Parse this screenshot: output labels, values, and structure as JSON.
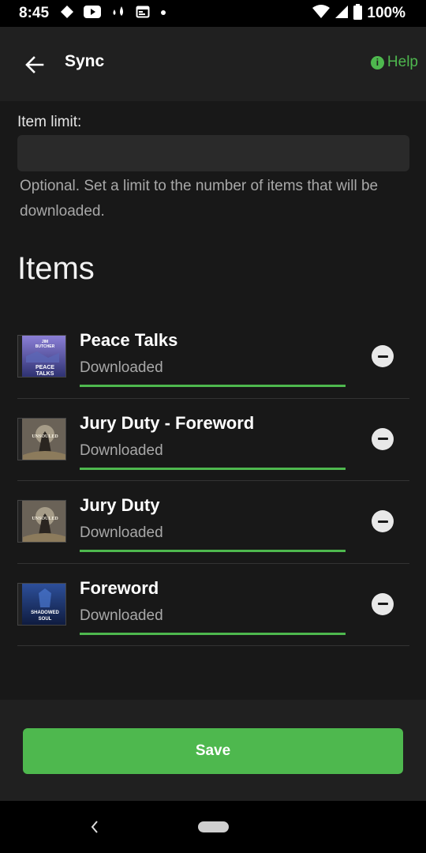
{
  "status_bar": {
    "time": "8:45",
    "battery_text": "100%",
    "icons_left": [
      "notification-diamond-icon",
      "youtube-icon",
      "drops-icon",
      "calendar-icon",
      "dot-icon"
    ],
    "icons_right": [
      "wifi-icon",
      "signal-icon",
      "battery-icon"
    ]
  },
  "app_bar": {
    "title": "Sync",
    "help_label": "Help",
    "back_icon": "arrow-left-icon",
    "help_icon": "info-icon"
  },
  "item_limit": {
    "label": "Item limit:",
    "value": "",
    "placeholder": "",
    "help_text": "Optional. Set a limit to the number of items that will be downloaded."
  },
  "items_section": {
    "heading": "Items",
    "items": [
      {
        "title": "Peace Talks",
        "status": "Downloaded",
        "progress": 1.0,
        "cover_text": [
          "JIM",
          "BUTCHER",
          "PEACE",
          "TALKS"
        ]
      },
      {
        "title": "Jury Duty - Foreword",
        "status": "Downloaded",
        "progress": 1.0,
        "cover_text": [
          "UNSOULED"
        ]
      },
      {
        "title": "Jury Duty",
        "status": "Downloaded",
        "progress": 1.0,
        "cover_text": [
          "UNSOULED"
        ]
      },
      {
        "title": "Foreword",
        "status": "Downloaded",
        "progress": 1.0,
        "cover_text": [
          "SHADOWED",
          "SOUL"
        ]
      }
    ]
  },
  "footer": {
    "save_label": "Save"
  },
  "colors": {
    "accent": "#4eb84e",
    "background": "#181818",
    "surface": "#202020",
    "input": "#2a2a2a",
    "secondary_text": "#a8a8a8"
  }
}
